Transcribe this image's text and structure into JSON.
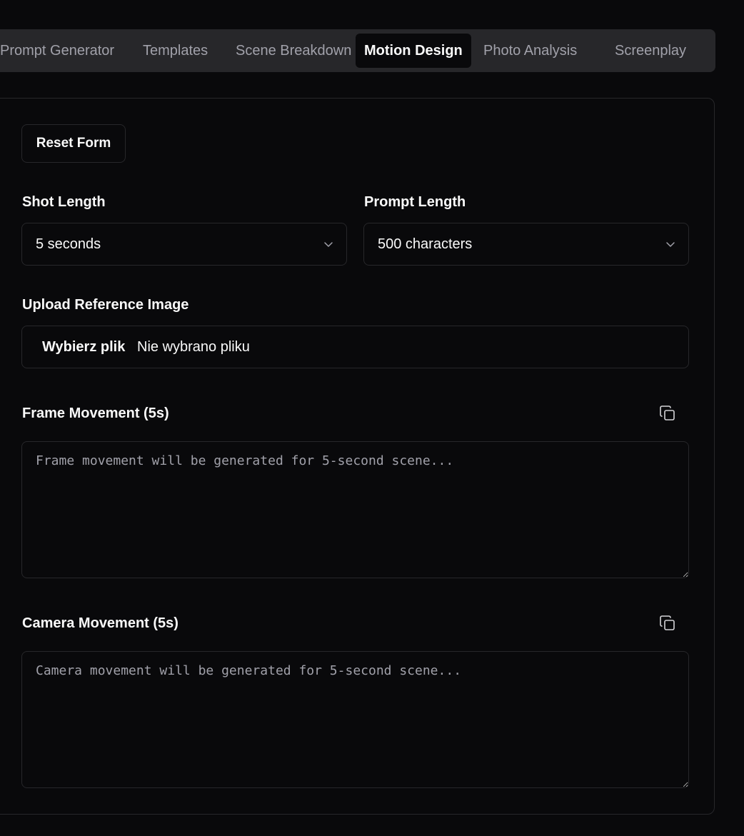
{
  "tabs": [
    {
      "label": "Prompt Generator"
    },
    {
      "label": "Templates"
    },
    {
      "label": "Scene Breakdown"
    },
    {
      "label": "Motion Design",
      "active": true
    },
    {
      "label": "Photo Analysis"
    },
    {
      "label": "Screenplay"
    }
  ],
  "form": {
    "reset_label": "Reset Form",
    "shot_length": {
      "label": "Shot Length",
      "value": "5 seconds"
    },
    "prompt_length": {
      "label": "Prompt Length",
      "value": "500 characters"
    },
    "upload": {
      "label": "Upload Reference Image",
      "button": "Wybierz plik",
      "status": "Nie wybrano pliku"
    },
    "frame_movement": {
      "label": "Frame Movement (5s)",
      "placeholder": "Frame movement will be generated for 5-second scene..."
    },
    "camera_movement": {
      "label": "Camera Movement (5s)",
      "placeholder": "Camera movement will be generated for 5-second scene..."
    }
  },
  "icons": {
    "copy": "copy-icon",
    "chevron": "chevron-down-icon"
  },
  "colors": {
    "background": "#09090b",
    "tabbar": "#27272a",
    "border": "#27272a",
    "muted_text": "#a1a1aa"
  }
}
